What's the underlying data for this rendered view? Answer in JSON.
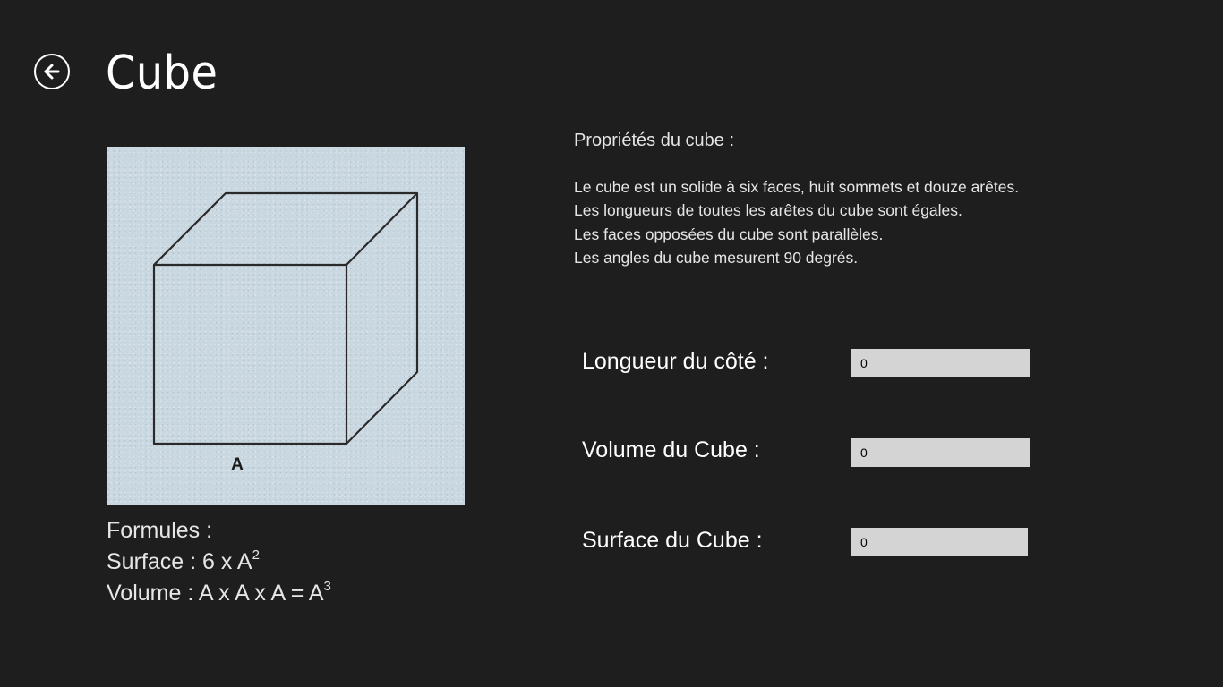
{
  "header": {
    "back_icon": "back-arrow-icon",
    "title": "Cube"
  },
  "figure": {
    "label": "A"
  },
  "formulas": {
    "heading": "Formules :",
    "surface_prefix": "Surface : 6 x A",
    "surface_exp": "2",
    "volume_prefix": "Volume : A x A x A = A",
    "volume_exp": "3"
  },
  "properties": {
    "title": "Propriétés du cube :",
    "lines": [
      "Le cube est un solide à six faces, huit sommets et douze arêtes.",
      "Les longueurs de toutes les arêtes du cube sont égales.",
      "Les faces opposées du cube sont parallèles.",
      "Les angles du cube mesurent 90 degrés."
    ]
  },
  "fields": {
    "side": {
      "label": "Longueur du côté :",
      "value": "0"
    },
    "volume": {
      "label": "Volume du Cube :",
      "value": "0"
    },
    "surface": {
      "label": "Surface du Cube :",
      "value": "0"
    }
  },
  "colors": {
    "background": "#1e1e1e",
    "figure_background": "#c9d7e0",
    "input_background": "#d4d4d4"
  }
}
